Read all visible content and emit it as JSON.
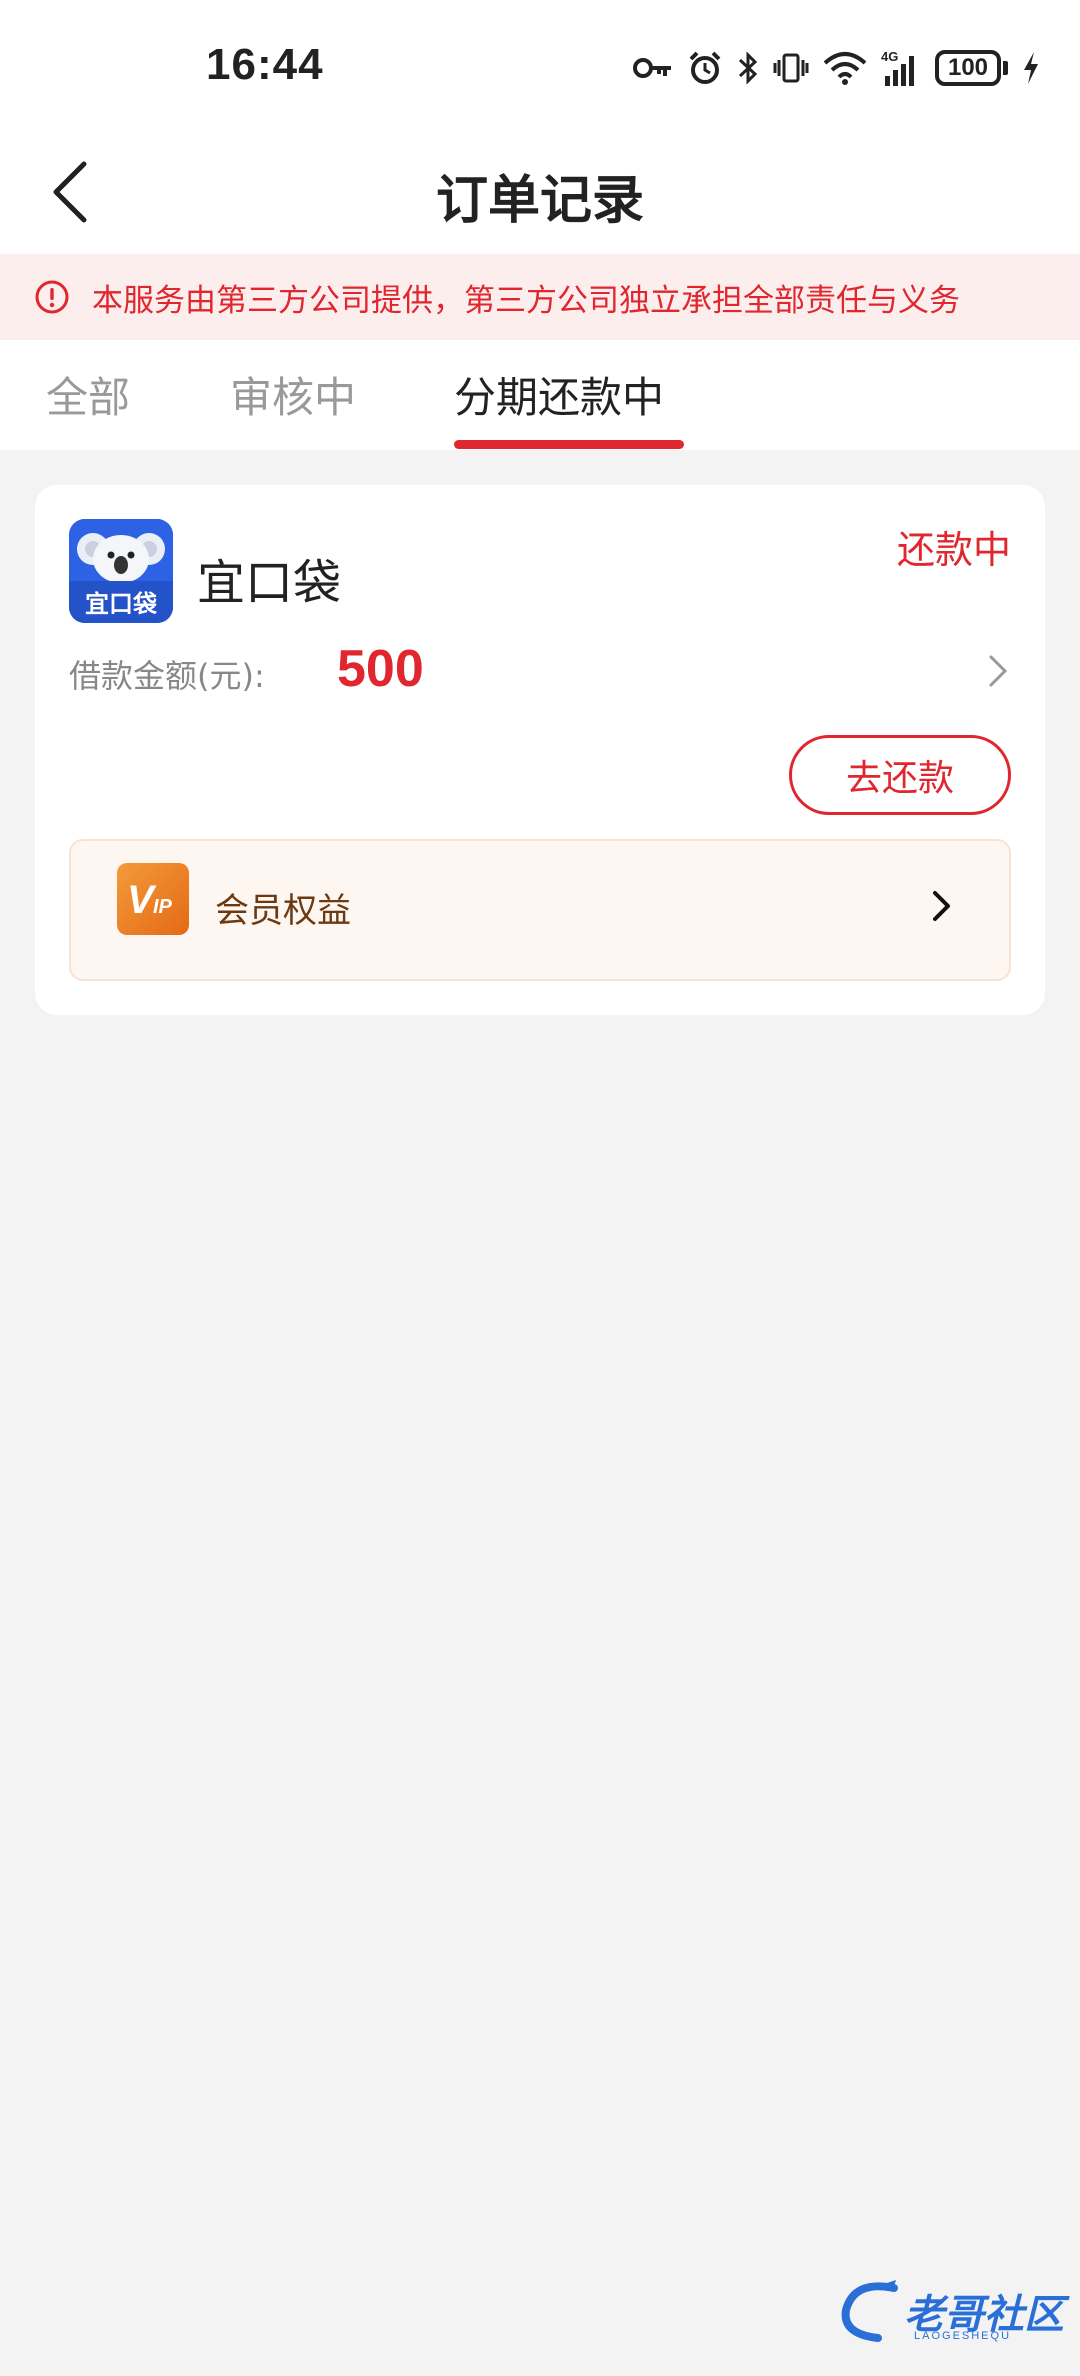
{
  "status_bar": {
    "time": "16:44",
    "battery": "100",
    "icons": [
      "key-icon",
      "alarm-icon",
      "bluetooth-icon",
      "vibrate-icon",
      "wifi-icon",
      "signal-4g-icon",
      "battery-icon",
      "charging-icon"
    ]
  },
  "header": {
    "title": "订单记录",
    "back_icon": "chevron-left-icon"
  },
  "notice": {
    "text": "本服务由第三方公司提供，第三方公司独立承担全部责任与义务",
    "icon": "alert-circle-icon"
  },
  "tabs": [
    {
      "label": "全部",
      "active": false
    },
    {
      "label": "审核中",
      "active": false
    },
    {
      "label": "分期还款中",
      "active": true
    }
  ],
  "order": {
    "app_name": "宜口袋",
    "logo_text": "宜口袋",
    "status": "还款中",
    "amount_label": "借款金额(元):",
    "amount_value": "500",
    "repay_button": "去还款",
    "vip_label": "会员权益",
    "vip_icon_text": "VIP"
  },
  "watermark": {
    "text": "老哥社区",
    "sub": "LAOGESHEQU"
  },
  "colors": {
    "accent": "#e0262e",
    "notice_bg": "#fdeeee",
    "page_bg": "#f3f3f3",
    "vip_bg": "#fef6f0"
  }
}
